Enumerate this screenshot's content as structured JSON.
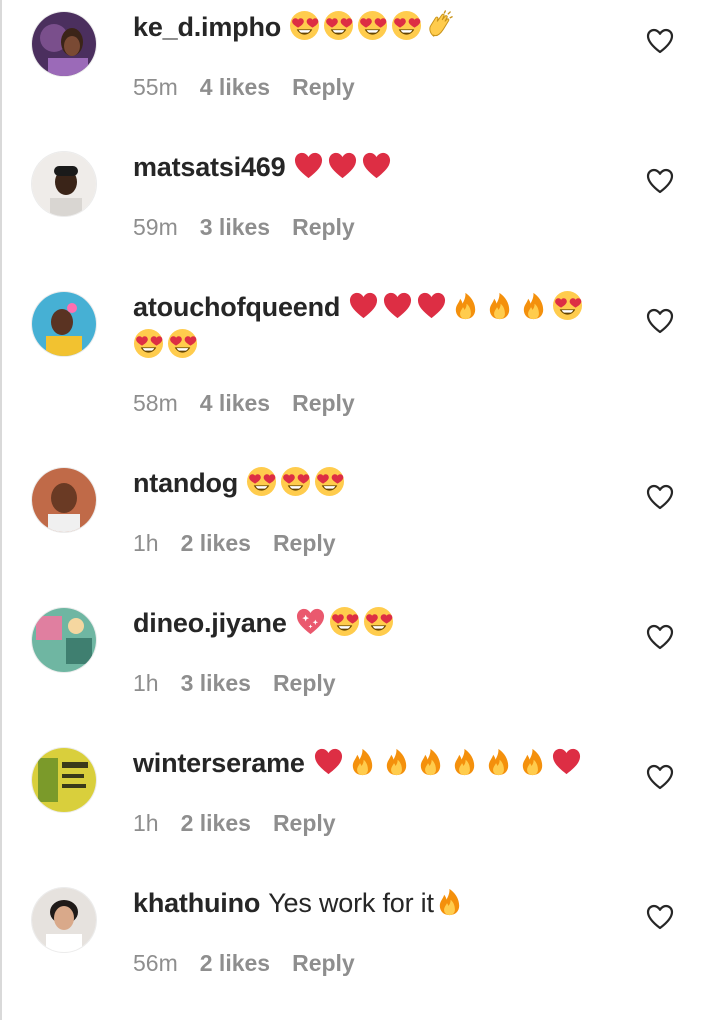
{
  "comments": [
    {
      "username": "ke_d.impho",
      "text": "",
      "emojis": [
        "heart-eyes",
        "heart-eyes",
        "heart-eyes",
        "heart-eyes",
        "clap"
      ],
      "time": "55m",
      "likes": "4 likes",
      "reply": "Reply",
      "avatar_color": "#6b4a8a"
    },
    {
      "username": "matsatsi469",
      "text": "",
      "emojis": [
        "red-heart",
        "red-heart",
        "red-heart"
      ],
      "time": "59m",
      "likes": "3 likes",
      "reply": "Reply",
      "avatar_color": "#e9e6e2"
    },
    {
      "username": "atouchofqueend",
      "text": "",
      "emojis": [
        "red-heart",
        "red-heart",
        "red-heart",
        "fire",
        "fire",
        "fire",
        "heart-eyes",
        "heart-eyes",
        "heart-eyes"
      ],
      "time": "58m",
      "likes": "4 likes",
      "reply": "Reply",
      "avatar_color": "#3aa7c9"
    },
    {
      "username": "ntandog",
      "text": "",
      "emojis": [
        "heart-eyes",
        "heart-eyes",
        "heart-eyes"
      ],
      "time": "1h",
      "likes": "2 likes",
      "reply": "Reply",
      "avatar_color": "#b85a3a"
    },
    {
      "username": "dineo.jiyane",
      "text": "",
      "emojis": [
        "sparkling-heart",
        "heart-eyes",
        "heart-eyes"
      ],
      "time": "1h",
      "likes": "3 likes",
      "reply": "Reply",
      "avatar_color": "#5aa08e"
    },
    {
      "username": "winterserame",
      "text": "",
      "emojis": [
        "red-heart",
        "fire",
        "fire",
        "fire",
        "fire",
        "fire",
        "fire",
        "red-heart"
      ],
      "time": "1h",
      "likes": "2 likes",
      "reply": "Reply",
      "avatar_color": "#c9c23a"
    },
    {
      "username": "khathuino",
      "text": "Yes work for it",
      "emojis": [
        "fire"
      ],
      "time": "56m",
      "likes": "2 likes",
      "reply": "Reply",
      "avatar_color": "#d9d4d0"
    }
  ],
  "icons": {
    "like": "heart-outline-icon"
  },
  "colors": {
    "username": "#262626",
    "meta": "#8e8e8e",
    "heart_red": "#dd2e44",
    "emoji_yellow": "#ffcc4d"
  }
}
